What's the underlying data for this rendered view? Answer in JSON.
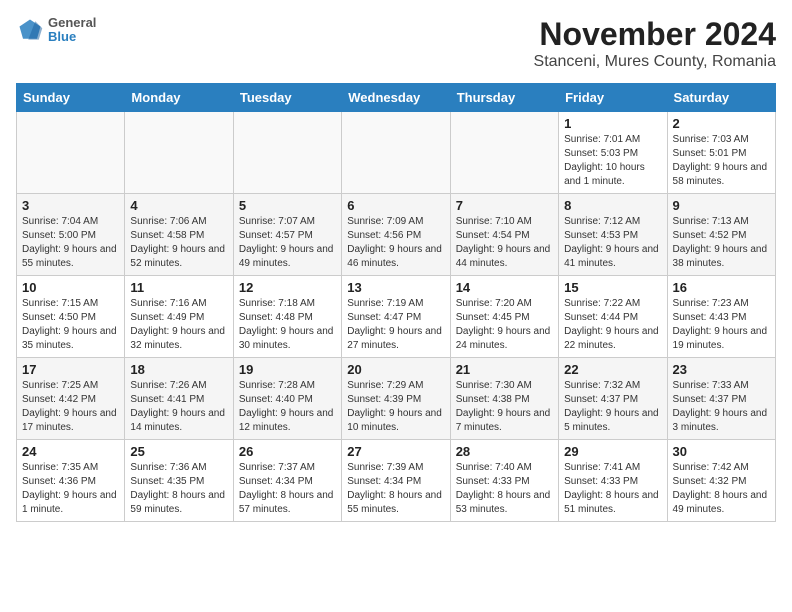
{
  "logo": {
    "text1": "General",
    "text2": "Blue"
  },
  "title": "November 2024",
  "subtitle": "Stanceni, Mures County, Romania",
  "days_of_week": [
    "Sunday",
    "Monday",
    "Tuesday",
    "Wednesday",
    "Thursday",
    "Friday",
    "Saturday"
  ],
  "weeks": [
    {
      "days": [
        {
          "num": "",
          "info": ""
        },
        {
          "num": "",
          "info": ""
        },
        {
          "num": "",
          "info": ""
        },
        {
          "num": "",
          "info": ""
        },
        {
          "num": "",
          "info": ""
        },
        {
          "num": "1",
          "info": "Sunrise: 7:01 AM\nSunset: 5:03 PM\nDaylight: 10 hours and 1 minute."
        },
        {
          "num": "2",
          "info": "Sunrise: 7:03 AM\nSunset: 5:01 PM\nDaylight: 9 hours and 58 minutes."
        }
      ]
    },
    {
      "days": [
        {
          "num": "3",
          "info": "Sunrise: 7:04 AM\nSunset: 5:00 PM\nDaylight: 9 hours and 55 minutes."
        },
        {
          "num": "4",
          "info": "Sunrise: 7:06 AM\nSunset: 4:58 PM\nDaylight: 9 hours and 52 minutes."
        },
        {
          "num": "5",
          "info": "Sunrise: 7:07 AM\nSunset: 4:57 PM\nDaylight: 9 hours and 49 minutes."
        },
        {
          "num": "6",
          "info": "Sunrise: 7:09 AM\nSunset: 4:56 PM\nDaylight: 9 hours and 46 minutes."
        },
        {
          "num": "7",
          "info": "Sunrise: 7:10 AM\nSunset: 4:54 PM\nDaylight: 9 hours and 44 minutes."
        },
        {
          "num": "8",
          "info": "Sunrise: 7:12 AM\nSunset: 4:53 PM\nDaylight: 9 hours and 41 minutes."
        },
        {
          "num": "9",
          "info": "Sunrise: 7:13 AM\nSunset: 4:52 PM\nDaylight: 9 hours and 38 minutes."
        }
      ]
    },
    {
      "days": [
        {
          "num": "10",
          "info": "Sunrise: 7:15 AM\nSunset: 4:50 PM\nDaylight: 9 hours and 35 minutes."
        },
        {
          "num": "11",
          "info": "Sunrise: 7:16 AM\nSunset: 4:49 PM\nDaylight: 9 hours and 32 minutes."
        },
        {
          "num": "12",
          "info": "Sunrise: 7:18 AM\nSunset: 4:48 PM\nDaylight: 9 hours and 30 minutes."
        },
        {
          "num": "13",
          "info": "Sunrise: 7:19 AM\nSunset: 4:47 PM\nDaylight: 9 hours and 27 minutes."
        },
        {
          "num": "14",
          "info": "Sunrise: 7:20 AM\nSunset: 4:45 PM\nDaylight: 9 hours and 24 minutes."
        },
        {
          "num": "15",
          "info": "Sunrise: 7:22 AM\nSunset: 4:44 PM\nDaylight: 9 hours and 22 minutes."
        },
        {
          "num": "16",
          "info": "Sunrise: 7:23 AM\nSunset: 4:43 PM\nDaylight: 9 hours and 19 minutes."
        }
      ]
    },
    {
      "days": [
        {
          "num": "17",
          "info": "Sunrise: 7:25 AM\nSunset: 4:42 PM\nDaylight: 9 hours and 17 minutes."
        },
        {
          "num": "18",
          "info": "Sunrise: 7:26 AM\nSunset: 4:41 PM\nDaylight: 9 hours and 14 minutes."
        },
        {
          "num": "19",
          "info": "Sunrise: 7:28 AM\nSunset: 4:40 PM\nDaylight: 9 hours and 12 minutes."
        },
        {
          "num": "20",
          "info": "Sunrise: 7:29 AM\nSunset: 4:39 PM\nDaylight: 9 hours and 10 minutes."
        },
        {
          "num": "21",
          "info": "Sunrise: 7:30 AM\nSunset: 4:38 PM\nDaylight: 9 hours and 7 minutes."
        },
        {
          "num": "22",
          "info": "Sunrise: 7:32 AM\nSunset: 4:37 PM\nDaylight: 9 hours and 5 minutes."
        },
        {
          "num": "23",
          "info": "Sunrise: 7:33 AM\nSunset: 4:37 PM\nDaylight: 9 hours and 3 minutes."
        }
      ]
    },
    {
      "days": [
        {
          "num": "24",
          "info": "Sunrise: 7:35 AM\nSunset: 4:36 PM\nDaylight: 9 hours and 1 minute."
        },
        {
          "num": "25",
          "info": "Sunrise: 7:36 AM\nSunset: 4:35 PM\nDaylight: 8 hours and 59 minutes."
        },
        {
          "num": "26",
          "info": "Sunrise: 7:37 AM\nSunset: 4:34 PM\nDaylight: 8 hours and 57 minutes."
        },
        {
          "num": "27",
          "info": "Sunrise: 7:39 AM\nSunset: 4:34 PM\nDaylight: 8 hours and 55 minutes."
        },
        {
          "num": "28",
          "info": "Sunrise: 7:40 AM\nSunset: 4:33 PM\nDaylight: 8 hours and 53 minutes."
        },
        {
          "num": "29",
          "info": "Sunrise: 7:41 AM\nSunset: 4:33 PM\nDaylight: 8 hours and 51 minutes."
        },
        {
          "num": "30",
          "info": "Sunrise: 7:42 AM\nSunset: 4:32 PM\nDaylight: 8 hours and 49 minutes."
        }
      ]
    }
  ]
}
